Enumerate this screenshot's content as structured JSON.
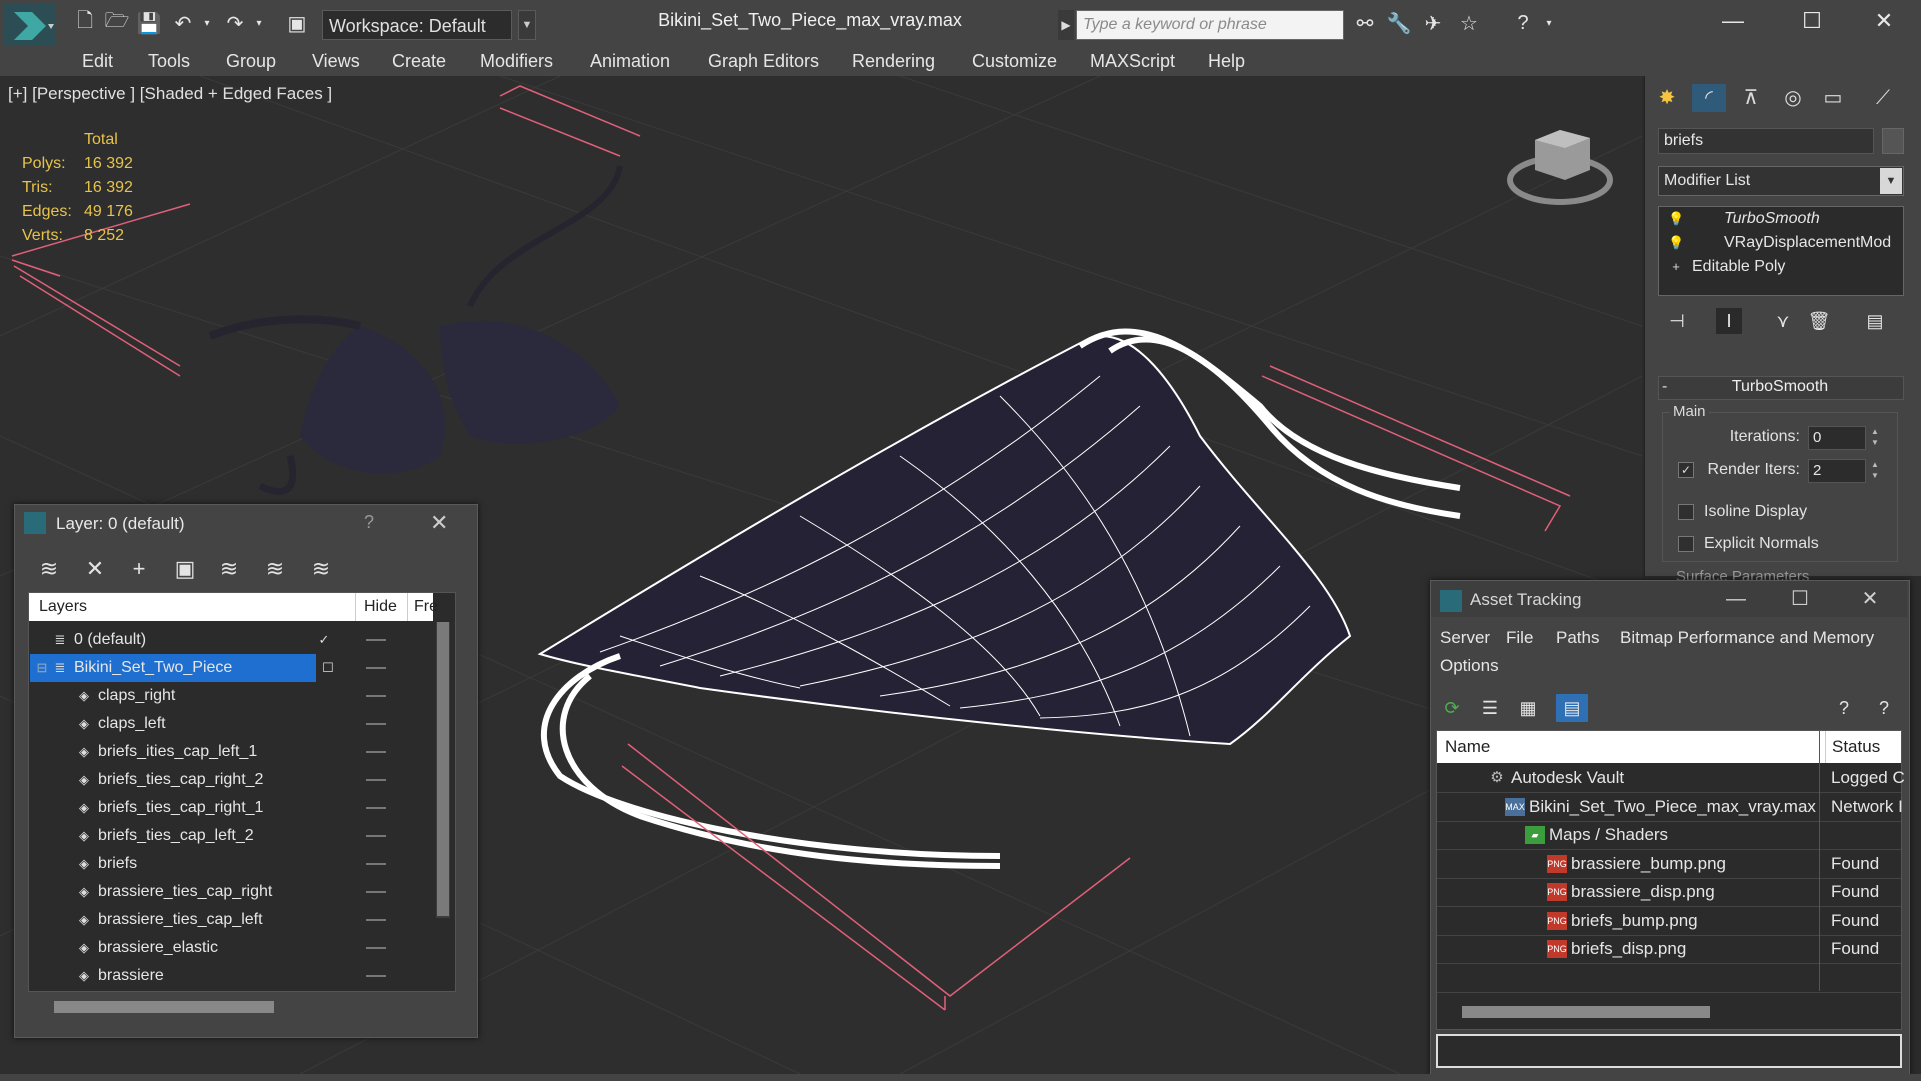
{
  "app": {
    "title": "Bikini_Set_Two_Piece_max_vray.max",
    "workspace": "Workspace: Default",
    "search_placeholder": "Type a keyword or phrase",
    "toolbar_icons": [
      "new-file-icon",
      "open-folder-icon",
      "save-icon",
      "undo-icon",
      "redo-icon",
      "project-folder-icon"
    ],
    "search_icons": [
      "binoculars-icon",
      "tools-icon",
      "pin-icon",
      "star-icon",
      "help-icon"
    ],
    "window_buttons": [
      "minimize",
      "maximize",
      "close"
    ]
  },
  "menu": [
    "Edit",
    "Tools",
    "Group",
    "Views",
    "Create",
    "Modifiers",
    "Animation",
    "Graph Editors",
    "Rendering",
    "Customize",
    "MAXScript",
    "Help"
  ],
  "viewport": {
    "label": "[+] [Perspective ] [Shaded + Edged Faces ]",
    "stats_header": "Total",
    "stats": [
      {
        "key": "Polys:",
        "value": "16 392"
      },
      {
        "key": "Tris:",
        "value": "16 392"
      },
      {
        "key": "Edges:",
        "value": "49 176"
      },
      {
        "key": "Verts:",
        "value": "8 252"
      }
    ]
  },
  "command_panel": {
    "object_name": "briefs",
    "modifier_list": "Modifier List",
    "stack": [
      "TurboSmooth",
      "VRayDisplacementMod",
      "Editable Poly"
    ],
    "rollout_title": "TurboSmooth",
    "group_main": "Main",
    "iterations_label": "Iterations:",
    "iterations_value": "0",
    "render_iters_label": "Render Iters:",
    "render_iters_value": "2",
    "render_iters_checked": true,
    "isoline_label": "Isoline Display",
    "explicit_normals_label": "Explicit Normals",
    "surface_params": "Surface Parameters"
  },
  "layer_window": {
    "title": "Layer: 0 (default)",
    "help": "?",
    "columns": {
      "layers": "Layers",
      "hide": "Hide",
      "freeze": "Fre"
    },
    "rows": [
      {
        "name": "0 (default)",
        "indent": 1,
        "type": "layer",
        "current": true
      },
      {
        "name": "Bikini_Set_Two_Piece",
        "indent": 1,
        "type": "layer",
        "selected": true
      },
      {
        "name": "claps_right",
        "indent": 2,
        "type": "object"
      },
      {
        "name": "claps_left",
        "indent": 2,
        "type": "object"
      },
      {
        "name": "briefs_ities_cap_left_1",
        "indent": 2,
        "type": "object"
      },
      {
        "name": "briefs_ties_cap_right_2",
        "indent": 2,
        "type": "object"
      },
      {
        "name": "briefs_ties_cap_right_1",
        "indent": 2,
        "type": "object"
      },
      {
        "name": "briefs_ties_cap_left_2",
        "indent": 2,
        "type": "object"
      },
      {
        "name": "briefs",
        "indent": 2,
        "type": "object"
      },
      {
        "name": "brassiere_ties_cap_right",
        "indent": 2,
        "type": "object"
      },
      {
        "name": "brassiere_ties_cap_left",
        "indent": 2,
        "type": "object"
      },
      {
        "name": "brassiere_elastic",
        "indent": 2,
        "type": "object"
      },
      {
        "name": "brassiere",
        "indent": 2,
        "type": "object"
      }
    ]
  },
  "asset_window": {
    "title": "Asset Tracking",
    "menu_row1": [
      "Server",
      "File",
      "Paths",
      "Bitmap Performance and Memory"
    ],
    "menu_row2": [
      "Options"
    ],
    "columns": {
      "name": "Name",
      "status": "Status"
    },
    "rows": [
      {
        "name": "Autodesk Vault",
        "status": "Logged C",
        "icon": "vault-icon"
      },
      {
        "name": "Bikini_Set_Two_Piece_max_vray.max",
        "status": "Network I",
        "icon": "max-file-icon"
      },
      {
        "name": "Maps / Shaders",
        "status": "",
        "icon": "maps-icon"
      },
      {
        "name": "brassiere_bump.png",
        "status": "Found",
        "icon": "png-icon"
      },
      {
        "name": "brassiere_disp.png",
        "status": "Found",
        "icon": "png-icon"
      },
      {
        "name": "briefs_bump.png",
        "status": "Found",
        "icon": "png-icon"
      },
      {
        "name": "briefs_disp.png",
        "status": "Found",
        "icon": "png-icon"
      }
    ]
  },
  "colors": {
    "ui_bg": "#444444",
    "viewport_bg": "#2e2e2e",
    "stats": "#e7c34a",
    "selection": "#1f6fd0",
    "bbox": "#e0607a",
    "wire": "#ffffff"
  }
}
